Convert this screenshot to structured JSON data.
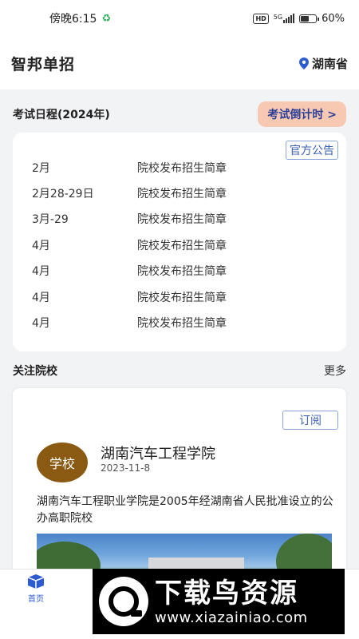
{
  "status_bar": {
    "time": "傍晚6:15",
    "hd": "HD",
    "network": "5G",
    "battery": "60%",
    "battery_level": 0.6
  },
  "header": {
    "app_title": "智邦单招",
    "location": "湖南省"
  },
  "schedule": {
    "title": "考试日程(2024年)",
    "countdown_label": "考试倒计时 >",
    "official_tag": "官方公告",
    "rows": [
      {
        "date": "2月",
        "event": "院校发布招生简章"
      },
      {
        "date": "2月28-29日",
        "event": "院校发布招生简章"
      },
      {
        "date": "3月-29",
        "event": "院校发布招生简章"
      },
      {
        "date": "4月",
        "event": "院校发布招生简章"
      },
      {
        "date": "4月",
        "event": "院校发布招生简章"
      },
      {
        "date": "4月",
        "event": "院校发布招生简章"
      },
      {
        "date": "4月",
        "event": "院校发布招生简章"
      }
    ]
  },
  "followed": {
    "title": "关注院校",
    "more_label": "更多",
    "college": {
      "subscribe_label": "订阅",
      "avatar_text": "学校",
      "name": "湖南汽车工程学院",
      "date": "2023-11-8",
      "description": "湖南汽车工程职业学院是2005年经湖南省人民批准设立的公办高职院校"
    }
  },
  "tabbar": {
    "home_label": "首页",
    "active_color": "#2d5bd0"
  },
  "watermark": {
    "title": "下载鸟资源",
    "url": "www.xiazainiao.com"
  }
}
